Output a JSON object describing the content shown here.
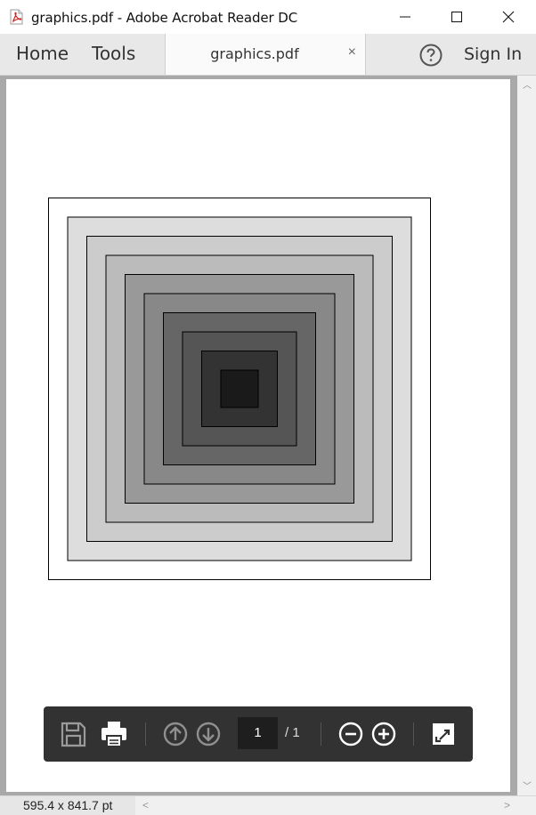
{
  "window": {
    "title": "graphics.pdf - Adobe Acrobat Reader DC",
    "app_icon": "pdf-file-icon",
    "controls": [
      "minimize-icon",
      "maximize-icon",
      "close-icon"
    ]
  },
  "nav": {
    "home_label": "Home",
    "tools_label": "Tools",
    "tab": {
      "label": "graphics.pdf",
      "close": "×"
    },
    "help_icon": "help-circle-icon",
    "signin_label": "Sign In"
  },
  "document": {
    "artwork": {
      "description_type": "nested-squares",
      "outer_fill": "#ffffff",
      "fills": [
        "#ffffff",
        "#dddddd",
        "#cccccc",
        "#bbbbbb",
        "#999999",
        "#888888",
        "#666666",
        "#555555",
        "#333333",
        "#1a1a1a"
      ],
      "stroke": "#000000"
    }
  },
  "toolbar": {
    "icons": [
      "save-icon",
      "print-icon",
      "prev-page-icon",
      "next-page-icon",
      "zoom-out-icon",
      "zoom-in-icon",
      "fit-page-icon"
    ],
    "current_page": "1",
    "total_pages": "/ 1"
  },
  "status": {
    "page_size": "595.4 x 841.7 pt"
  }
}
